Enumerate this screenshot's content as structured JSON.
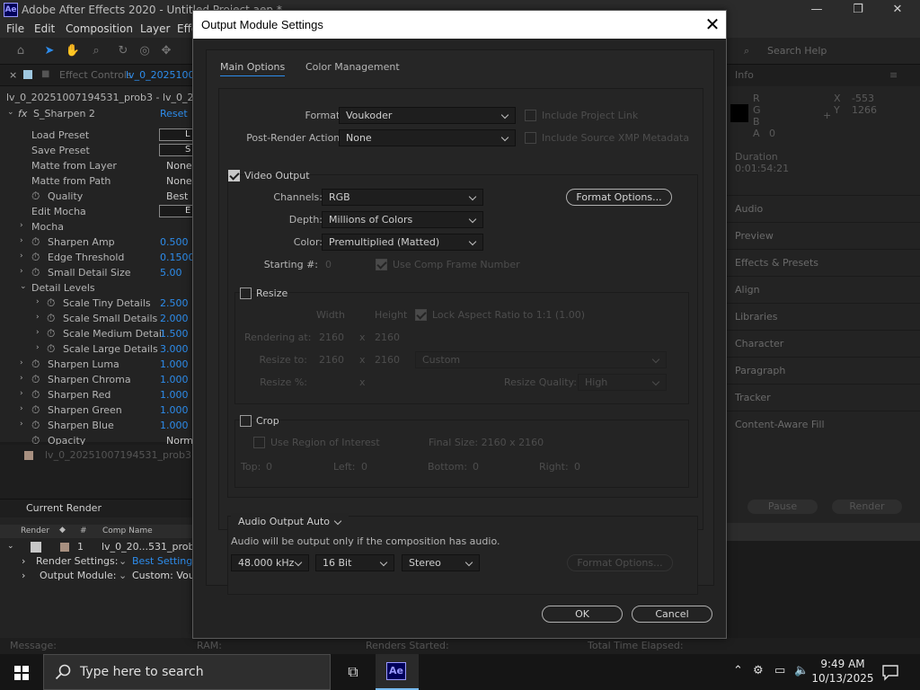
{
  "app": {
    "title": "Adobe After Effects 2020 - Untitled Project.aep *",
    "icon_text": "Ae",
    "window_controls": [
      "—",
      "❐",
      "✕"
    ],
    "menu": [
      "File",
      "Edit",
      "Composition",
      "Layer",
      "Effe"
    ],
    "search_help": "Search Help"
  },
  "effect_controls": {
    "tab_label": "Effect Controls",
    "tab_comp": "lv_0_2025100",
    "breadcrumb": "lv_0_20251007194531_prob3 - lv_0_2025",
    "effect_name": "S_Sharpen 2",
    "reset_label": "Reset",
    "rows": [
      {
        "label": "Load Preset",
        "box": "L"
      },
      {
        "label": "Save Preset",
        "box": "S"
      },
      {
        "label": "Matte from Layer",
        "value": "None"
      },
      {
        "label": "Matte from Path",
        "value": "None"
      },
      {
        "label": "Quality",
        "value": "Best"
      },
      {
        "label": "Edit Mocha",
        "box": "E"
      },
      {
        "label": "Mocha"
      },
      {
        "label": "Sharpen Amp",
        "value": "0.500"
      },
      {
        "label": "Edge Threshold",
        "value": "0.1500"
      },
      {
        "label": "Small Detail Size",
        "value": "5.00"
      },
      {
        "label": "Detail Levels"
      },
      {
        "label": "Scale Tiny Details",
        "value": "2.500"
      },
      {
        "label": "Scale Small Details",
        "value": "2.000"
      },
      {
        "label": "Scale Medium Detail",
        "value": "1.500"
      },
      {
        "label": "Scale Large Details",
        "value": "3.000"
      },
      {
        "label": "Sharpen Luma",
        "value": "1.000"
      },
      {
        "label": "Sharpen Chroma",
        "value": "1.000"
      },
      {
        "label": "Sharpen Red",
        "value": "1.000"
      },
      {
        "label": "Sharpen Green",
        "value": "1.000"
      },
      {
        "label": "Sharpen Blue",
        "value": "1.000"
      },
      {
        "label": "Opacity",
        "value": "Norma"
      }
    ],
    "project_item": "lv_0_20251007194531_prob3"
  },
  "render_queue": {
    "tab": "Current Render",
    "columns": [
      "Render",
      "#",
      "Comp Name"
    ],
    "item_number": "1",
    "item_name": "lv_0_20...531_prob3",
    "render_settings_label": "Render Settings:",
    "render_settings_value": "Best Settings",
    "output_module_label": "Output Module:",
    "output_module_value": "Custom: Vouko"
  },
  "status_bar": {
    "message": "Message:",
    "ram": "RAM:",
    "renders_started": "Renders Started:",
    "total_time": "Total Time Elapsed:"
  },
  "right_panel": {
    "info": "Info",
    "channels": [
      "R",
      "G",
      "B",
      "A"
    ],
    "alpha_value": "0",
    "x_label": "X",
    "x_value": "-553",
    "y_label": "Y",
    "y_value": "1266",
    "duration_label": "Duration",
    "duration_value": "0:01:54:21",
    "panels": [
      "Audio",
      "Preview",
      "Effects & Presets",
      "Align",
      "Libraries",
      "Character",
      "Paragraph",
      "Tracker",
      "Content-Aware Fill"
    ],
    "pause": "Pause",
    "render": "Render"
  },
  "dialog": {
    "title": "Output Module Settings",
    "close": "✕",
    "tabs": [
      "Main Options",
      "Color Management"
    ],
    "format_label": "Format:",
    "format_value": "Voukoder",
    "include_project_link": "Include Project Link",
    "post_render_label": "Post-Render Action:",
    "post_render_value": "None",
    "include_xmp": "Include Source XMP Metadata",
    "video_output": {
      "label": "Video Output",
      "checked": true,
      "channels_label": "Channels:",
      "channels_value": "RGB",
      "depth_label": "Depth:",
      "depth_value": "Millions of Colors",
      "color_label": "Color:",
      "color_value": "Premultiplied (Matted)",
      "format_options": "Format Options...",
      "starting_label": "Starting #:",
      "starting_value": "0",
      "use_comp_frame": "Use Comp Frame Number"
    },
    "resize": {
      "label": "Resize",
      "checked": false,
      "width_header": "Width",
      "height_header": "Height",
      "lock_aspect": "Lock Aspect Ratio to 1:1 (1.00)",
      "rendering_at_label": "Rendering at:",
      "rendering_w": "2160",
      "rendering_h": "2160",
      "resize_to_label": "Resize to:",
      "resize_w": "2160",
      "resize_h": "2160",
      "preset": "Custom",
      "resize_pct_label": "Resize %:",
      "x": "x",
      "quality_label": "Resize Quality:",
      "quality_value": "High"
    },
    "crop": {
      "label": "Crop",
      "checked": false,
      "use_roi": "Use Region of Interest",
      "final_size": "Final Size: 2160 x 2160",
      "top_label": "Top:",
      "top": "0",
      "left_label": "Left:",
      "left": "0",
      "bottom_label": "Bottom:",
      "bottom": "0",
      "right_label": "Right:",
      "right": "0"
    },
    "audio": {
      "output_mode": "Audio Output Auto",
      "note": "Audio will be output only if the composition has audio.",
      "rate": "48.000 kHz",
      "bits": "16 Bit",
      "channels": "Stereo",
      "format_options": "Format Options..."
    },
    "ok": "OK",
    "cancel": "Cancel"
  },
  "taskbar": {
    "search_placeholder": "Type here to search",
    "app_icon": "Ae",
    "time": "9:49 AM",
    "date": "10/13/2025"
  }
}
